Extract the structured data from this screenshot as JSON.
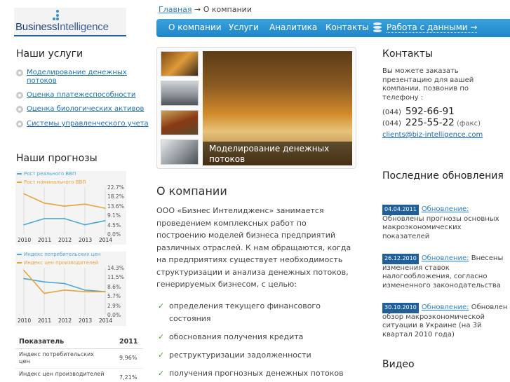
{
  "logo": {
    "word1": "Business",
    "word2": "Intelligence"
  },
  "breadcrumb": {
    "home": "Главная",
    "arrow": "→",
    "current": "О компании"
  },
  "nav": {
    "items": [
      "О компании",
      "Услуги",
      "Аналитика",
      "Контакты"
    ],
    "data_link": "Работа с данными →"
  },
  "services": {
    "title": "Наши услуги",
    "items": [
      "Моделирование денежных потоков",
      "Оценка платежеспособности",
      "Оценка биологических активов",
      "Системы управленческого учета"
    ]
  },
  "forecasts": {
    "title": "Наши прогнозы"
  },
  "chart_data": [
    {
      "type": "line",
      "x": [
        "2010",
        "2011",
        "2012",
        "2013",
        "2014"
      ],
      "series": [
        {
          "name": "Рост реального ВВП",
          "values": [
            4.5,
            7.5,
            7.5,
            4.5,
            6.5
          ],
          "color": "#4aa7d6"
        },
        {
          "name": "Рост номинального ВВП",
          "values": [
            19.5,
            15.0,
            13.5,
            14.5,
            12.5
          ],
          "color": "#e8a33a"
        }
      ],
      "yticks": [
        "22.7%",
        "18.2%",
        "13.6%",
        "9.1%",
        "4.5%",
        "0.0%"
      ],
      "ylim": [
        0,
        22.7
      ]
    },
    {
      "type": "line",
      "x": [
        "2010",
        "2011",
        "2012",
        "2013",
        "2014"
      ],
      "series": [
        {
          "name": "Индекс потребительских цен",
          "values": [
            11.0,
            10.0,
            9.5,
            7.5,
            7.0
          ],
          "color": "#4aa7d6"
        },
        {
          "name": "Индекс цен производителей",
          "values": [
            13.5,
            6.5,
            7.5,
            7.0,
            7.0
          ],
          "color": "#e8a33a"
        }
      ],
      "yticks": [
        "14.3%",
        "11.5%",
        "8.6%",
        "5.7%",
        "2.9%",
        "0.0%"
      ],
      "ylim": [
        0,
        14.3
      ]
    }
  ],
  "table": {
    "headers": [
      "Показатель",
      "2011"
    ],
    "rows": [
      {
        "name": "Индекс потребительских цен",
        "value": "9,96%"
      },
      {
        "name": "Индекс цен производителей",
        "value": "7,21%"
      }
    ]
  },
  "slider": {
    "caption": "Моделирование денежных потоков"
  },
  "about": {
    "title": "О компании",
    "text": "ООО «Бизнес Интелидженс» занимается проведением комплексных работ по построению моделей бизнеса предприятий различных отраслей. К нам обращаются, когда на предприятиях существует необходимость структуризации и анализа денежных потоков, генерируемых бизнесом, с целью:",
    "goals": [
      "определения текущего финансового состояния",
      "обоснования получения кредита",
      "реструктуризации задолженности",
      "получения прогнозных денежных потоков"
    ]
  },
  "contacts": {
    "title": "Контакты",
    "text": "Вы можете заказать презентацию для вашей компании, позвонив по телефону :",
    "phone1_code": "(044)",
    "phone1": "592-66-91",
    "phone2_code": "(044)",
    "phone2": "225-55-22",
    "phone2_note": "(факс)",
    "email": "clients@biz-intelligence.com"
  },
  "updates": {
    "title": "Последние обновления",
    "items": [
      {
        "date": "04.04.2011",
        "label": "Обновление:",
        "text": "Обновлены прогнозы основных макроэкономических показателей"
      },
      {
        "date": "26.12.2010",
        "label": "Обновление:",
        "text": "Внесены изменения ставок налогообложения, согласно измененного законодательства"
      },
      {
        "date": "30.10.2010",
        "label": "Обновление:",
        "text": "Обновлен обзор макроэкономической ситуации в Украине (на 3й квартал 2010 года)"
      }
    ]
  },
  "video": {
    "title": "Видео"
  },
  "colors": {
    "nav": "#2a94d2",
    "link": "#1a6fb5",
    "date_badge": "#1f5f9a",
    "check": "#57a23a"
  }
}
